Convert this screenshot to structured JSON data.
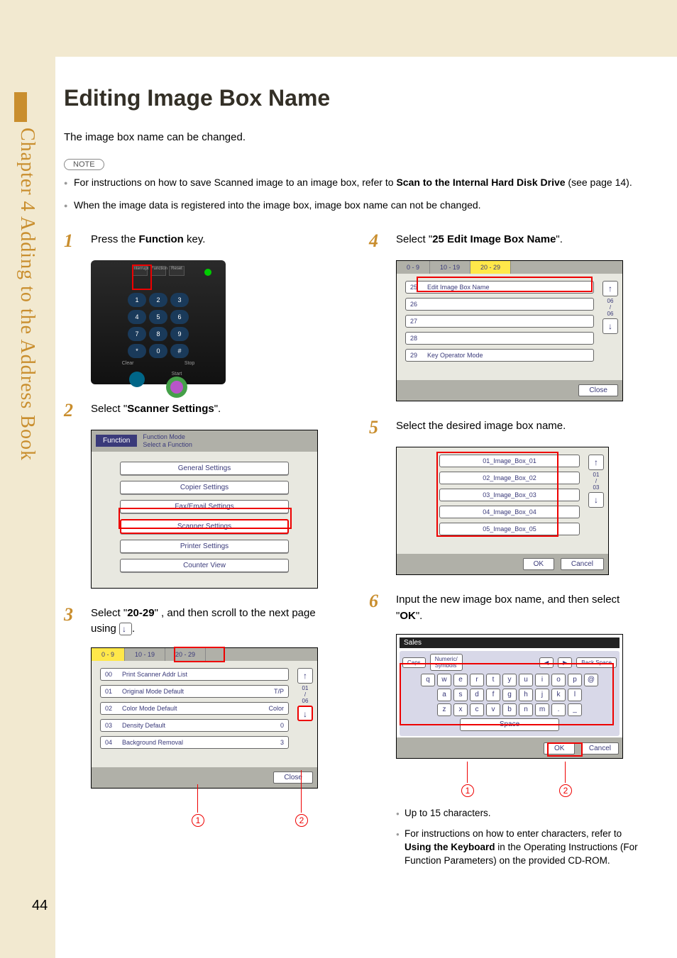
{
  "page": {
    "number": "44",
    "chapter_vertical": "Chapter 4    Adding to the Address Book",
    "title": "Editing Image Box Name",
    "intro": "The image box name can be changed.",
    "note_label": "NOTE"
  },
  "notes": {
    "n1_a": "For instructions on how to save Scanned image to an image box, refer to ",
    "n1_b": "Scan to the Internal Hard Disk Drive",
    "n1_c": " (see page 14).",
    "n2": "When the image data is registered into the image box, image box name can not be changed."
  },
  "steps": {
    "s1_a": "Press the ",
    "s1_b": "Function",
    "s1_c": " key.",
    "s2_a": "Select \"",
    "s2_b": "Scanner Settings",
    "s2_c": "\".",
    "s3_a": "Select \"",
    "s3_b": "20-29",
    "s3_c": "\" , and then scroll to the next page using ",
    "s3_d": ".",
    "s4_a": "Select \"",
    "s4_b": "25 Edit Image Box Name",
    "s4_c": "\".",
    "s5": "Select the desired image box name.",
    "s6_a": "Input the new image box name, and then select \"",
    "s6_b": "OK",
    "s6_c": "\"."
  },
  "device": {
    "top": [
      "Interrupt",
      "Function",
      "Reset"
    ],
    "keys": [
      "1",
      "2",
      "3",
      "4",
      "5",
      "6",
      "7",
      "8",
      "9",
      "*",
      "0",
      "#"
    ],
    "labels": {
      "clear": "Clear",
      "stop": "Stop",
      "start": "Start"
    }
  },
  "panel2": {
    "fn_label": "Function",
    "head1": "Function Mode",
    "head2": "Select a Function",
    "items": [
      "General Settings",
      "Copier Settings",
      "Fax/Email Settings",
      "Scanner Settings",
      "Printer Settings",
      "Counter View"
    ]
  },
  "panel3": {
    "tabs": [
      "0 - 9",
      "10 - 19",
      "20 - 29"
    ],
    "rows": [
      {
        "n": "00",
        "t": "Print Scanner Addr List",
        "v": ""
      },
      {
        "n": "01",
        "t": "Original Mode Default",
        "v": "T/P"
      },
      {
        "n": "02",
        "t": "Color Mode Default",
        "v": "Color"
      },
      {
        "n": "03",
        "t": "Density Default",
        "v": "0"
      },
      {
        "n": "04",
        "t": "Background Removal",
        "v": "3"
      }
    ],
    "scroll": "01\n/\n06",
    "close": "Close"
  },
  "panel4": {
    "tabs": [
      "0 - 9",
      "10 - 19",
      "20 - 29"
    ],
    "rows": [
      {
        "n": "25",
        "t": "Edit Image Box Name"
      },
      {
        "n": "26",
        "t": ""
      },
      {
        "n": "27",
        "t": ""
      },
      {
        "n": "28",
        "t": ""
      },
      {
        "n": "29",
        "t": "Key Operator Mode"
      }
    ],
    "scroll": "06\n/\n06",
    "close": "Close"
  },
  "panel5": {
    "rows": [
      "01_Image_Box_01",
      "02_Image_Box_02",
      "03_Image_Box_03",
      "04_Image_Box_04",
      "05_Image_Box_05"
    ],
    "scroll": "01\n/\n03",
    "ok": "OK",
    "cancel": "Cancel"
  },
  "panel6": {
    "display": "Sales",
    "caps": "Caps",
    "numsym": "Numeric/\nSymbols",
    "back": "Back Space",
    "rows": [
      [
        "q",
        "w",
        "e",
        "r",
        "t",
        "y",
        "u",
        "i",
        "o",
        "p",
        "@"
      ],
      [
        "a",
        "s",
        "d",
        "f",
        "g",
        "h",
        "j",
        "k",
        "l"
      ],
      [
        "z",
        "x",
        "c",
        "v",
        "b",
        "n",
        "m",
        ".",
        "_"
      ]
    ],
    "space": "Space",
    "ok": "OK",
    "cancel": "Cancel"
  },
  "subnotes": {
    "a": "Up to 15 characters.",
    "b1": "For instructions on how to enter characters, refer to ",
    "b2": "Using the Keyboard",
    "b3": " in the Operating Instructions (For Function Parameters) on the provided CD-ROM."
  },
  "callouts": {
    "c1": "1",
    "c2": "2"
  }
}
